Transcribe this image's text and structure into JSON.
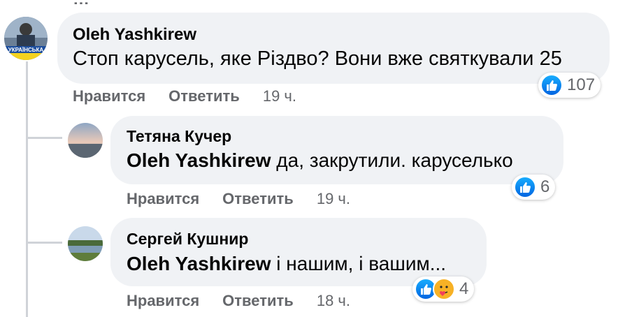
{
  "header_fragment": "…",
  "comments": [
    {
      "author": "Oleh Yashkirew",
      "avatar_badge": "УКРАЇНСЬКА",
      "text": "Стоп карусель, яке Різдво? Вони вже святкували 25",
      "like_label": "Нравится",
      "reply_label": "Ответить",
      "time": "19 ч.",
      "reaction_count": "107",
      "reactions": [
        "like-icon"
      ]
    },
    {
      "author": "Тетяна Кучер",
      "mention": "Oleh Yashkirew",
      "text": " да, закрутили. каруселько",
      "like_label": "Нравится",
      "reply_label": "Ответить",
      "time": "19 ч.",
      "reaction_count": "6",
      "reactions": [
        "like-icon"
      ]
    },
    {
      "author": "Сергей Кушнир",
      "mention": "Oleh Yashkirew",
      "text": " і нашим, і вашим...",
      "like_label": "Нравится",
      "reply_label": "Ответить",
      "time": "18 ч.",
      "reaction_count": "4",
      "reactions": [
        "like-icon",
        "care-icon"
      ]
    }
  ],
  "colors": {
    "bubble": "#f0f2f5",
    "secondary_text": "#65676b",
    "like_blue": "#1877f2",
    "thread_line": "#d0d3d8"
  }
}
